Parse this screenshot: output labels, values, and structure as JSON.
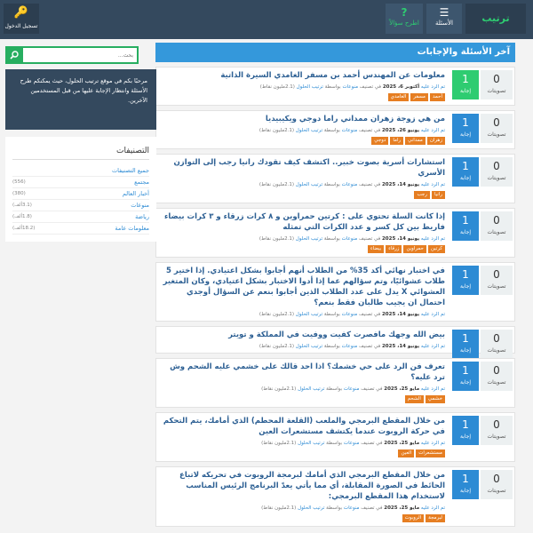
{
  "header": {
    "logo": "ترتيب الحلول",
    "nav": {
      "questions": "الأسئلة",
      "questions_icon": "☰",
      "ask": "اطرح سؤالاً",
      "ask_icon": "?"
    },
    "login": {
      "label": "تسجيل الدخول",
      "icon": "🔑"
    }
  },
  "main": {
    "title": "آخر الأسئلة والإجابات",
    "votes_label": "تصويتات",
    "answers_label": "إجابة",
    "questions": [
      {
        "title": "معلومات عن المهندس أحمد بن مسفر الغامدي السيرة الذاتية",
        "votes": "0",
        "answers": "1",
        "answers_color": "green",
        "meta": {
          "action": "تم الرد عليه",
          "date": "أكتوبر 6، 2025",
          "category_prefix": "في تصنيف",
          "category": "منوعات",
          "by": "بواسطة",
          "user": "ترتيب الحلول",
          "points": "(2.1مليون نقاط)"
        },
        "tags": [
          "أحمد",
          "مسفر",
          "الغامدي"
        ]
      },
      {
        "title": "من هي زوجة زهران ممداني راما دوجي ويكيبيديا",
        "votes": "0",
        "answers": "1",
        "answers_color": "blue",
        "meta": {
          "action": "تم الرد عليه",
          "date": "يونيو 26، 2025",
          "category_prefix": "في تصنيف",
          "category": "منوعات",
          "by": "بواسطة",
          "user": "ترتيب الحلول",
          "points": "(2.1مليون نقاط)"
        },
        "tags": [
          "زهران",
          "ممداني",
          "راما",
          "دوجي"
        ]
      },
      {
        "title": "استشارات أسرية بصوت خبير.. اكتشف كيف تقودك رانيا رجب إلى التوازن الأسري",
        "votes": "0",
        "answers": "1",
        "answers_color": "blue",
        "meta": {
          "action": "تم الرد عليه",
          "date": "يونيو 14، 2025",
          "category_prefix": "في تصنيف",
          "category": "منوعات",
          "by": "بواسطة",
          "user": "ترتيب الحلول",
          "points": "(2.1مليون نقاط)"
        },
        "tags": [
          "رانيا",
          "رجب"
        ]
      },
      {
        "title": "إذا كانت السلة تحتوي على : كرتين حمراوين و ٨ كرات زرقاء و ٣ كرات بيضاء فاريط بين كل كسر و عدد الكرات التي تمثله",
        "votes": "0",
        "answers": "1",
        "answers_color": "blue",
        "meta": {
          "action": "تم الرد عليه",
          "date": "يونيو 14، 2025",
          "category_prefix": "في تصنيف",
          "category": "منوعات",
          "by": "بواسطة",
          "user": "ترتيب الحلول",
          "points": "(2.1مليون نقاط)"
        },
        "tags": [
          "كرتين",
          "حمراوين",
          "زرقاء",
          "بيضاء"
        ]
      },
      {
        "title": "في اختبار نهائي أكد 35% من الطلاب أنهم أجابوا بشكل اعتيادي. إذا اختير 5 طلاب عشوائيًا، وتم سؤالهم عما إذا أدوا الاختبار بشكل اعتيادي، وكان المتغير العشوائي X يدل على عدد الطلاب الذين أجابوا بنعم عن السؤال أوجدي احتمال ان يجيب طالبان فقط بنعم؟",
        "votes": "0",
        "answers": "1",
        "answers_color": "blue",
        "meta": {
          "action": "تم الرد عليه",
          "date": "يونيو 14، 2025",
          "category_prefix": "في تصنيف",
          "category": "منوعات",
          "by": "بواسطة",
          "user": "ترتيب الحلول",
          "points": "(2.1مليون نقاط)"
        },
        "tags": []
      },
      {
        "title": "بيض الله وجهك مافصرت كفيت ووفيت في المملكة و تويتر",
        "votes": "0",
        "answers": "1",
        "answers_color": "blue",
        "meta": {
          "action": "تم الرد عليه",
          "date": "يونيو 14، 2025",
          "category_prefix": "في تصنيف",
          "category": "منوعات",
          "by": "بواسطة",
          "user": "ترتيب الحلول",
          "points": "(2.1مليون نقاط)"
        },
        "tags": []
      },
      {
        "title": "تعرف فن الرد على حي خشمك؟ اذا احد قالك على خشمي عليه الشحم وش ترد عليه؟",
        "votes": "0",
        "answers": "1",
        "answers_color": "blue",
        "meta": {
          "action": "تم الرد عليه",
          "date": "مايو 25، 2025",
          "category_prefix": "في تصنيف",
          "category": "منوعات",
          "by": "بواسطة",
          "user": "ترتيب الحلول",
          "points": "(2.1مليون نقاط)"
        },
        "tags": [
          "خشمي",
          "الشحم"
        ]
      },
      {
        "title": "من خلال المقطع البرمجي والملعب (القلعة المحطم) الذي أمامك، يتم التحكم في حركة الروبوت عندما يكتشف مستشعرات العين",
        "votes": "0",
        "answers": "1",
        "answers_color": "blue",
        "meta": {
          "action": "تم الرد عليه",
          "date": "مايو 25، 2025",
          "category_prefix": "في تصنيف",
          "category": "منوعات",
          "by": "بواسطة",
          "user": "ترتيب الحلول",
          "points": "(2.1مليون نقاط)"
        },
        "tags": [
          "مستشعرات",
          "العين"
        ]
      },
      {
        "title": "من خلال المقطع البرمجي الذي أمامك لبرمجة الروبوت في تحريكه لاتباع الحائط في الصورة المقابلة، أي مما يأتي يعدّ البرنامج الرئيس المناسب لاستخدام هذا المقطع البرمجي:",
        "votes": "0",
        "answers": "1",
        "answers_color": "blue",
        "meta": {
          "action": "تم الرد عليه",
          "date": "مايو 25، 2025",
          "category_prefix": "في تصنيف",
          "category": "منوعات",
          "by": "بواسطة",
          "user": "ترتيب الحلول",
          "points": "(2.1مليون نقاط)"
        },
        "tags": [
          "لبرمجة",
          "الروبوت"
        ]
      }
    ]
  },
  "sidebar": {
    "search": {
      "placeholder": "بحث...",
      "icon": "search-icon"
    },
    "welcome": "مرحبًا بكم في موقع ترتيب الحلول، حيث يمكنكم طرح الأسئلة وانتظار الإجابة عليها من قبل المستخدمين الآخرين.",
    "categories_title": "التصنيفات",
    "categories": [
      {
        "name": "جميع التصنيفات",
        "count": ""
      },
      {
        "name": "مجتمع",
        "count": "(556)"
      },
      {
        "name": "أخبار العالم",
        "count": "(380)"
      },
      {
        "name": "منوعات",
        "count": "(3.1ألف)"
      },
      {
        "name": "رياضة",
        "count": "(1.8ألف)"
      },
      {
        "name": "معلومات عامة",
        "count": "(18.2ألف)"
      }
    ]
  },
  "colors": {
    "header": "#34495e",
    "accent_green": "#2ecc71",
    "accent_blue": "#3498db",
    "tag": "#e67e22"
  }
}
